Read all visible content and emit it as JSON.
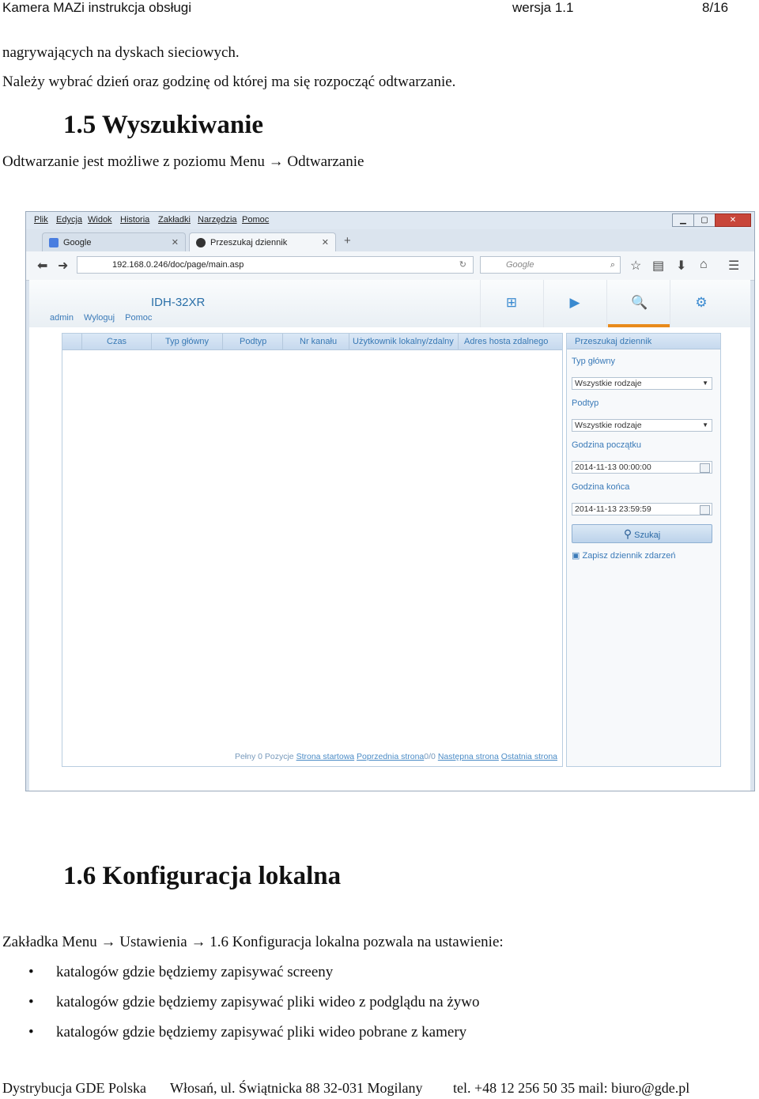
{
  "header": {
    "title": "Kamera MAZi instrukcja obsługi",
    "version": "wersja 1.1",
    "page": "8/16"
  },
  "intro": {
    "line1": "nagrywających na dyskach sieciowych.",
    "line2": "Należy wybrać dzień oraz godzinę od której ma się rozpocząć odtwarzanie."
  },
  "section15": {
    "heading": "1.5  Wyszukiwanie",
    "text": "Odtwarzanie jest możliwe z poziomu Menu → Odtwarzanie"
  },
  "browser": {
    "menu": [
      "Plik",
      "Edycja",
      "Widok",
      "Historia",
      "Zakładki",
      "Narzędzia",
      "Pomoc"
    ],
    "tabs": [
      "Google",
      "Przeszukaj dziennik"
    ],
    "url": "192.168.0.246/doc/page/main.asp",
    "search_placeholder": "Google",
    "app": {
      "model": "IDH-32XR",
      "user_links": [
        "admin",
        "Wyloguj",
        "Pomoc"
      ],
      "columns": [
        "Czas",
        "Typ główny",
        "Podtyp",
        "Nr kanału",
        "Użytkownik lokalny/zdalny",
        "Adres hosta zdalnego"
      ],
      "pager": {
        "total": "Pełny 0 Pozycje",
        "first": "Strona startowa",
        "prev": "Poprzednia strona",
        "count": "0/0",
        "next": "Następna strona",
        "last": "Ostatnia strona"
      },
      "panel": {
        "title": "Przeszukaj dziennik",
        "type_label": "Typ główny",
        "type_value": "Wszystkie rodzaje",
        "subtype_label": "Podtyp",
        "subtype_value": "Wszystkie rodzaje",
        "start_label": "Godzina początku",
        "start_value": "2014-11-13 00:00:00",
        "end_label": "Godzina końca",
        "end_value": "2014-11-13 23:59:59",
        "search_button": "Szukaj",
        "save_log": "Zapisz dziennik zdarzeń"
      }
    }
  },
  "section16": {
    "heading": "1.6  Konfiguracja lokalna",
    "text": "Zakładka Menu → Ustawienia →  1.6  Konfiguracja lokalna pozwala na ustawienie:",
    "bullets": [
      "katalogów gdzie będziemy zapisywać screeny",
      "katalogów gdzie będziemy zapisywać pliki wideo z podglądu na żywo",
      "katalogów gdzie będziemy zapisywać pliki wideo pobrane z kamery"
    ]
  },
  "footer": {
    "company": "Dystrybucja GDE Polska",
    "address": "Włosań, ul. Świątnicka 88 32-031 Mogilany",
    "contact": "tel. +48 12 256 50 35 mail: biuro@gde.pl"
  }
}
